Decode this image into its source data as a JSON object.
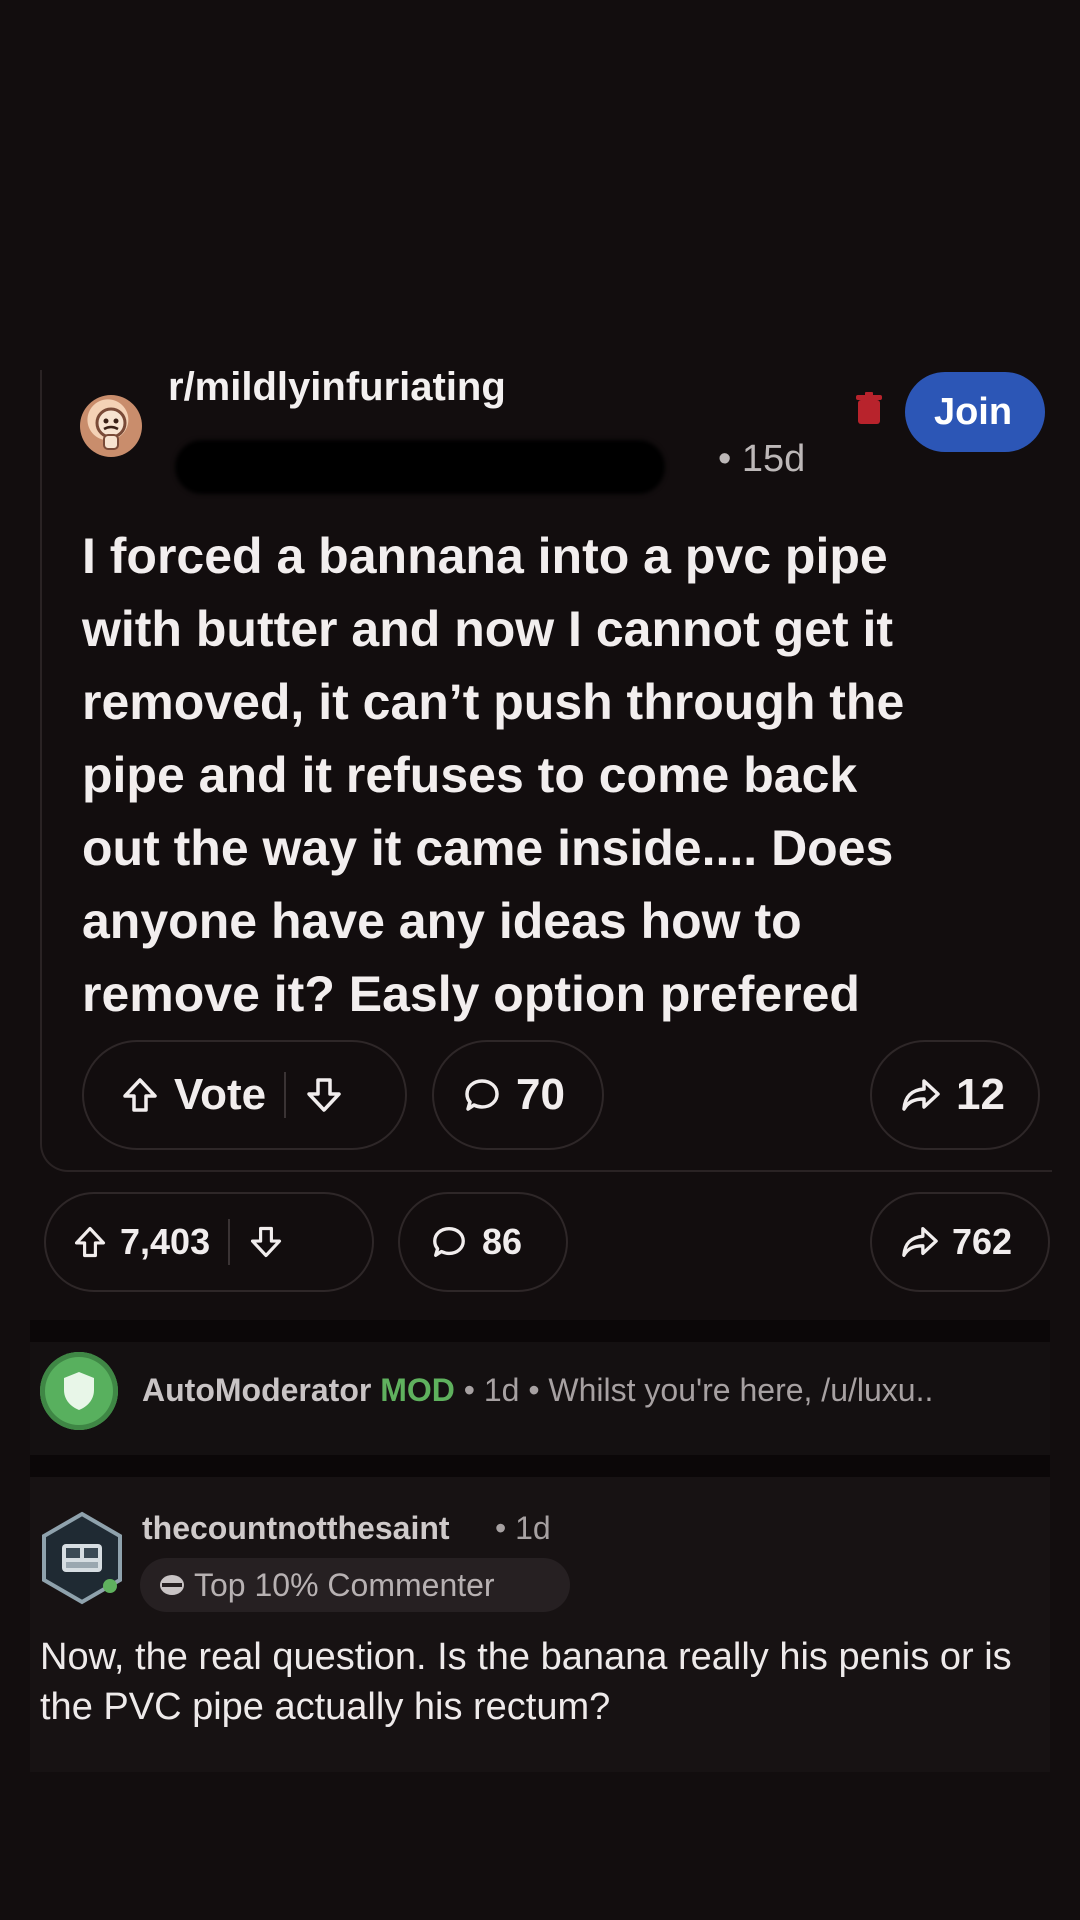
{
  "quoted_post": {
    "subreddit": "r/mildlyinfuriating",
    "age": "• 15d",
    "join_label": "Join",
    "title": "I forced a bannana into a pvc pipe\nwith butter and now I cannot get it\nremoved, it can’t push through the\npipe and it refuses to come back\nout the way it came inside.... Does\nanyone have any ideas how to\nremove it? Easly option prefered",
    "vote_label": "Vote",
    "comment_count": "70",
    "share_count": "12"
  },
  "outer_post": {
    "vote_count": "7,403",
    "comment_count": "86",
    "share_count": "762"
  },
  "automod_comment": {
    "name": "AutoModerator",
    "badge": "MOD",
    "rest": " • 1d • Whilst you're here, /u/luxu.."
  },
  "top_comment": {
    "username": "thecountnotthesaint",
    "age": "• 1d",
    "badge": "Top 10% Commenter",
    "text": "Now, the real question. Is the banana really his penis or is the PVC pipe actually his rectum?"
  },
  "colors": {
    "background": "#120d0e",
    "join_button": "#2c56b6",
    "mod_green": "#5fb15e"
  },
  "icons": [
    "upvote-icon",
    "downvote-icon",
    "comment-icon",
    "share-icon",
    "delete-icon",
    "shield-icon",
    "award-icon"
  ]
}
